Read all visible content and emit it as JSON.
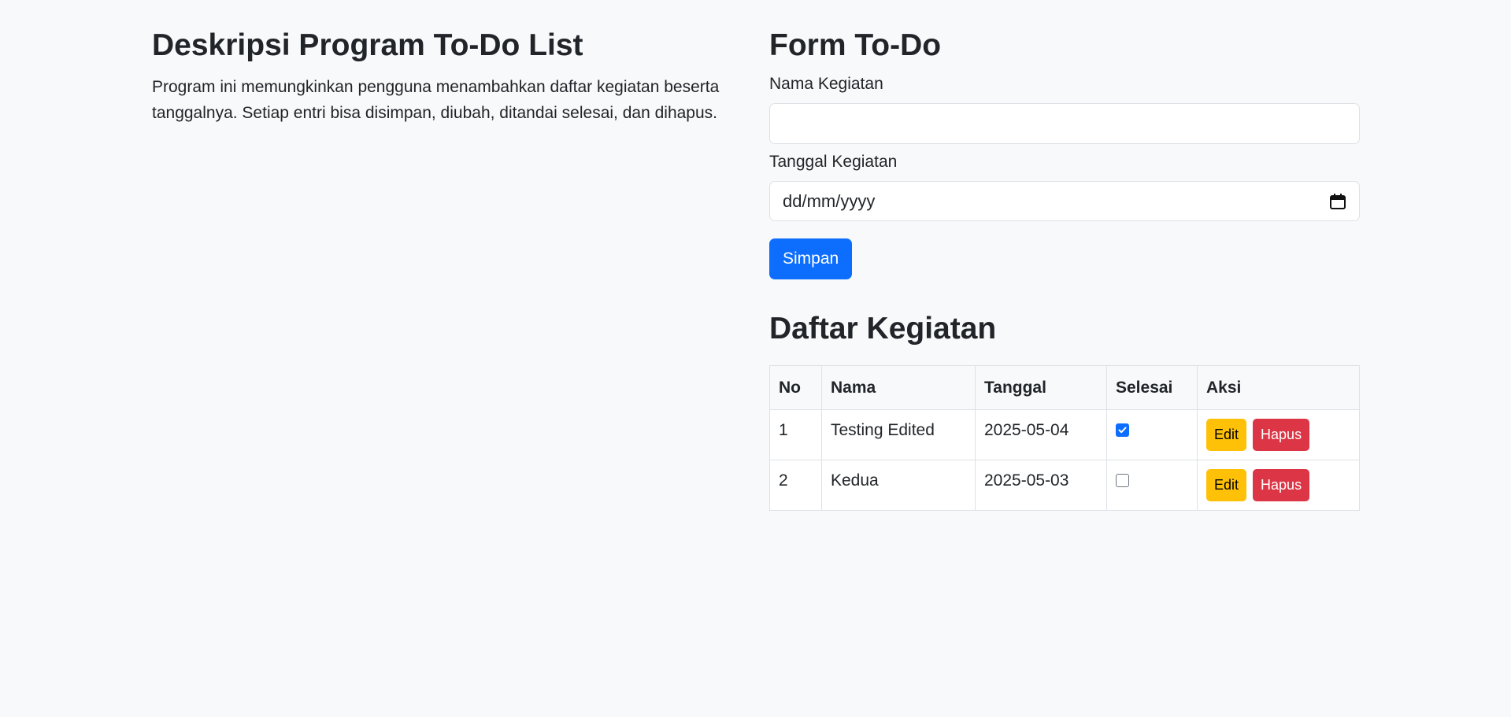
{
  "description": {
    "title": "Deskripsi Program To-Do List",
    "text": "Program ini memungkinkan pengguna menambahkan daftar kegiatan beserta tanggalnya. Setiap entri bisa disimpan, diubah, ditandai selesai, dan dihapus."
  },
  "form": {
    "title": "Form To-Do",
    "name_label": "Nama Kegiatan",
    "name_value": "",
    "date_label": "Tanggal Kegiatan",
    "date_placeholder": "dd/mm/yyyy",
    "submit_label": "Simpan"
  },
  "list": {
    "title": "Daftar Kegiatan",
    "headers": [
      "No",
      "Nama",
      "Tanggal",
      "Selesai",
      "Aksi"
    ],
    "rows": [
      {
        "no": "1",
        "nama": "Testing Edited",
        "tanggal": "2025-05-04",
        "selesai": true,
        "edit_label": "Edit",
        "delete_label": "Hapus"
      },
      {
        "no": "2",
        "nama": "Kedua",
        "tanggal": "2025-05-03",
        "selesai": false,
        "edit_label": "Edit",
        "delete_label": "Hapus"
      }
    ]
  },
  "colors": {
    "primary": "#0d6efd",
    "warning": "#ffc107",
    "danger": "#dc3545",
    "background": "#f8f9fa"
  }
}
